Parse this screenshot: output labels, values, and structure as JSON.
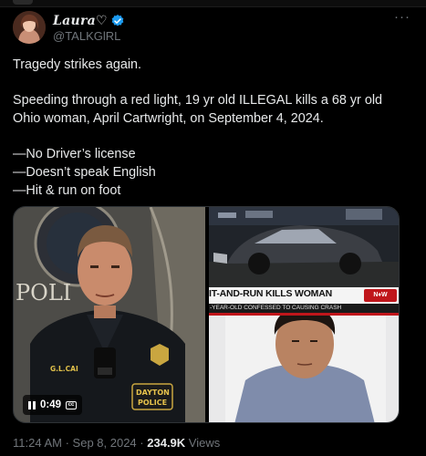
{
  "author": {
    "display_name": "Laura♡",
    "handle": "@TALKGlRL",
    "verified_icon": "verified-badge-icon",
    "more_icon": "more-options-icon"
  },
  "tweet": {
    "lines": [
      "Tragedy strikes again.",
      "",
      "Speeding through a red light, 19 yr old ILLEGAL kills a 68 yr old",
      "Ohio woman, April Cartwright, on September 4, 2024.",
      "",
      "—No Driver’s license",
      "—Doesn’t speak English",
      "—Hit & run on foot"
    ]
  },
  "media": {
    "video": {
      "duration": "0:49",
      "badge_text": "G.L.CAI",
      "patch_text": "DAYTON",
      "patch_text2": "POLICE",
      "sign_text": "POLI"
    },
    "news": {
      "headline": "IT-AND-RUN KILLS WOMAN",
      "subline": "-YEAR-OLD CONFESSED TO CAUSING CRASH",
      "badge": "N♦W"
    }
  },
  "footer": {
    "time": "11:24 AM",
    "date": "Sep 8, 2024",
    "views_count": "234.9K",
    "views_label": "Views"
  },
  "colors": {
    "background": "#000000",
    "text": "#e7e9ea",
    "muted": "#71767b",
    "verified": "#1d9bf0"
  }
}
